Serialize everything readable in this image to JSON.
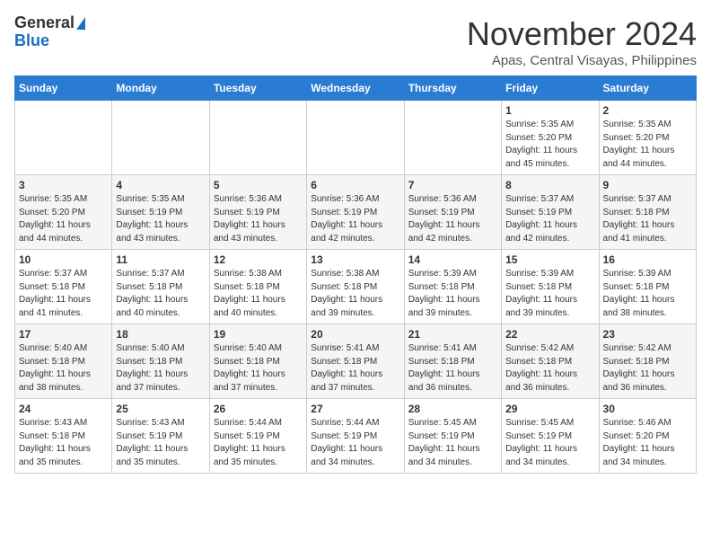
{
  "logo": {
    "general": "General",
    "blue": "Blue"
  },
  "title": "November 2024",
  "location": "Apas, Central Visayas, Philippines",
  "days_of_week": [
    "Sunday",
    "Monday",
    "Tuesday",
    "Wednesday",
    "Thursday",
    "Friday",
    "Saturday"
  ],
  "weeks": [
    [
      {
        "day": "",
        "info": ""
      },
      {
        "day": "",
        "info": ""
      },
      {
        "day": "",
        "info": ""
      },
      {
        "day": "",
        "info": ""
      },
      {
        "day": "",
        "info": ""
      },
      {
        "day": "1",
        "info": "Sunrise: 5:35 AM\nSunset: 5:20 PM\nDaylight: 11 hours\nand 45 minutes."
      },
      {
        "day": "2",
        "info": "Sunrise: 5:35 AM\nSunset: 5:20 PM\nDaylight: 11 hours\nand 44 minutes."
      }
    ],
    [
      {
        "day": "3",
        "info": "Sunrise: 5:35 AM\nSunset: 5:20 PM\nDaylight: 11 hours\nand 44 minutes."
      },
      {
        "day": "4",
        "info": "Sunrise: 5:35 AM\nSunset: 5:19 PM\nDaylight: 11 hours\nand 43 minutes."
      },
      {
        "day": "5",
        "info": "Sunrise: 5:36 AM\nSunset: 5:19 PM\nDaylight: 11 hours\nand 43 minutes."
      },
      {
        "day": "6",
        "info": "Sunrise: 5:36 AM\nSunset: 5:19 PM\nDaylight: 11 hours\nand 42 minutes."
      },
      {
        "day": "7",
        "info": "Sunrise: 5:36 AM\nSunset: 5:19 PM\nDaylight: 11 hours\nand 42 minutes."
      },
      {
        "day": "8",
        "info": "Sunrise: 5:37 AM\nSunset: 5:19 PM\nDaylight: 11 hours\nand 42 minutes."
      },
      {
        "day": "9",
        "info": "Sunrise: 5:37 AM\nSunset: 5:18 PM\nDaylight: 11 hours\nand 41 minutes."
      }
    ],
    [
      {
        "day": "10",
        "info": "Sunrise: 5:37 AM\nSunset: 5:18 PM\nDaylight: 11 hours\nand 41 minutes."
      },
      {
        "day": "11",
        "info": "Sunrise: 5:37 AM\nSunset: 5:18 PM\nDaylight: 11 hours\nand 40 minutes."
      },
      {
        "day": "12",
        "info": "Sunrise: 5:38 AM\nSunset: 5:18 PM\nDaylight: 11 hours\nand 40 minutes."
      },
      {
        "day": "13",
        "info": "Sunrise: 5:38 AM\nSunset: 5:18 PM\nDaylight: 11 hours\nand 39 minutes."
      },
      {
        "day": "14",
        "info": "Sunrise: 5:39 AM\nSunset: 5:18 PM\nDaylight: 11 hours\nand 39 minutes."
      },
      {
        "day": "15",
        "info": "Sunrise: 5:39 AM\nSunset: 5:18 PM\nDaylight: 11 hours\nand 39 minutes."
      },
      {
        "day": "16",
        "info": "Sunrise: 5:39 AM\nSunset: 5:18 PM\nDaylight: 11 hours\nand 38 minutes."
      }
    ],
    [
      {
        "day": "17",
        "info": "Sunrise: 5:40 AM\nSunset: 5:18 PM\nDaylight: 11 hours\nand 38 minutes."
      },
      {
        "day": "18",
        "info": "Sunrise: 5:40 AM\nSunset: 5:18 PM\nDaylight: 11 hours\nand 37 minutes."
      },
      {
        "day": "19",
        "info": "Sunrise: 5:40 AM\nSunset: 5:18 PM\nDaylight: 11 hours\nand 37 minutes."
      },
      {
        "day": "20",
        "info": "Sunrise: 5:41 AM\nSunset: 5:18 PM\nDaylight: 11 hours\nand 37 minutes."
      },
      {
        "day": "21",
        "info": "Sunrise: 5:41 AM\nSunset: 5:18 PM\nDaylight: 11 hours\nand 36 minutes."
      },
      {
        "day": "22",
        "info": "Sunrise: 5:42 AM\nSunset: 5:18 PM\nDaylight: 11 hours\nand 36 minutes."
      },
      {
        "day": "23",
        "info": "Sunrise: 5:42 AM\nSunset: 5:18 PM\nDaylight: 11 hours\nand 36 minutes."
      }
    ],
    [
      {
        "day": "24",
        "info": "Sunrise: 5:43 AM\nSunset: 5:18 PM\nDaylight: 11 hours\nand 35 minutes."
      },
      {
        "day": "25",
        "info": "Sunrise: 5:43 AM\nSunset: 5:19 PM\nDaylight: 11 hours\nand 35 minutes."
      },
      {
        "day": "26",
        "info": "Sunrise: 5:44 AM\nSunset: 5:19 PM\nDaylight: 11 hours\nand 35 minutes."
      },
      {
        "day": "27",
        "info": "Sunrise: 5:44 AM\nSunset: 5:19 PM\nDaylight: 11 hours\nand 34 minutes."
      },
      {
        "day": "28",
        "info": "Sunrise: 5:45 AM\nSunset: 5:19 PM\nDaylight: 11 hours\nand 34 minutes."
      },
      {
        "day": "29",
        "info": "Sunrise: 5:45 AM\nSunset: 5:19 PM\nDaylight: 11 hours\nand 34 minutes."
      },
      {
        "day": "30",
        "info": "Sunrise: 5:46 AM\nSunset: 5:20 PM\nDaylight: 11 hours\nand 34 minutes."
      }
    ]
  ]
}
